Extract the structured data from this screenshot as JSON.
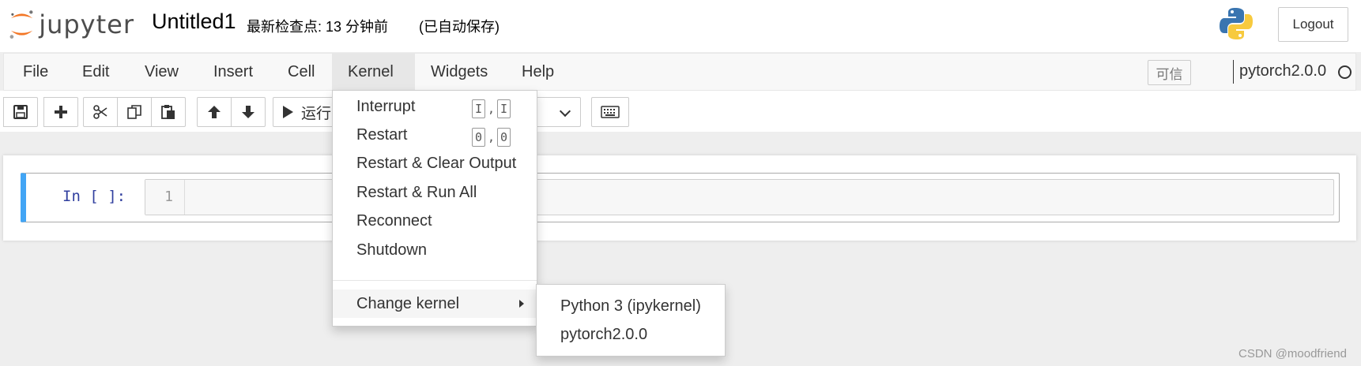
{
  "header": {
    "logo_text": "jupyter",
    "notebook_title": "Untitled1",
    "checkpoint": "最新检查点: 13 分钟前",
    "autosave": "(已自动保存)",
    "logout_label": "Logout"
  },
  "menubar": {
    "items": [
      "File",
      "Edit",
      "View",
      "Insert",
      "Cell",
      "Kernel",
      "Widgets",
      "Help"
    ],
    "active": "Kernel",
    "trusted_label": "可信",
    "kernel_name": "pytorch2.0.0"
  },
  "toolbar": {
    "run_label": "运行",
    "icons": [
      "save-icon",
      "plus-icon",
      "scissors-icon",
      "copy-icon",
      "paste-icon",
      "arrow-up-icon",
      "arrow-down-icon",
      "keyboard-icon"
    ]
  },
  "cell": {
    "prompt": "In [ ]:",
    "line_number": "1"
  },
  "kernel_menu": {
    "items": [
      {
        "label": "Interrupt",
        "shortcut": [
          "I",
          "I"
        ]
      },
      {
        "label": "Restart",
        "shortcut": [
          "0",
          "0"
        ]
      },
      {
        "label": "Restart & Clear Output"
      },
      {
        "label": "Restart & Run All"
      },
      {
        "label": "Reconnect"
      },
      {
        "label": "Shutdown"
      }
    ],
    "change_kernel_label": "Change kernel",
    "change_kernel_options": [
      "Python 3 (ipykernel)",
      "pytorch2.0.0"
    ]
  },
  "watermark": "CSDN @moodfriend",
  "colors": {
    "cell_selected_border": "#42a5f5",
    "prompt": "#303f9f",
    "jupyter_orange": "#f37726"
  }
}
